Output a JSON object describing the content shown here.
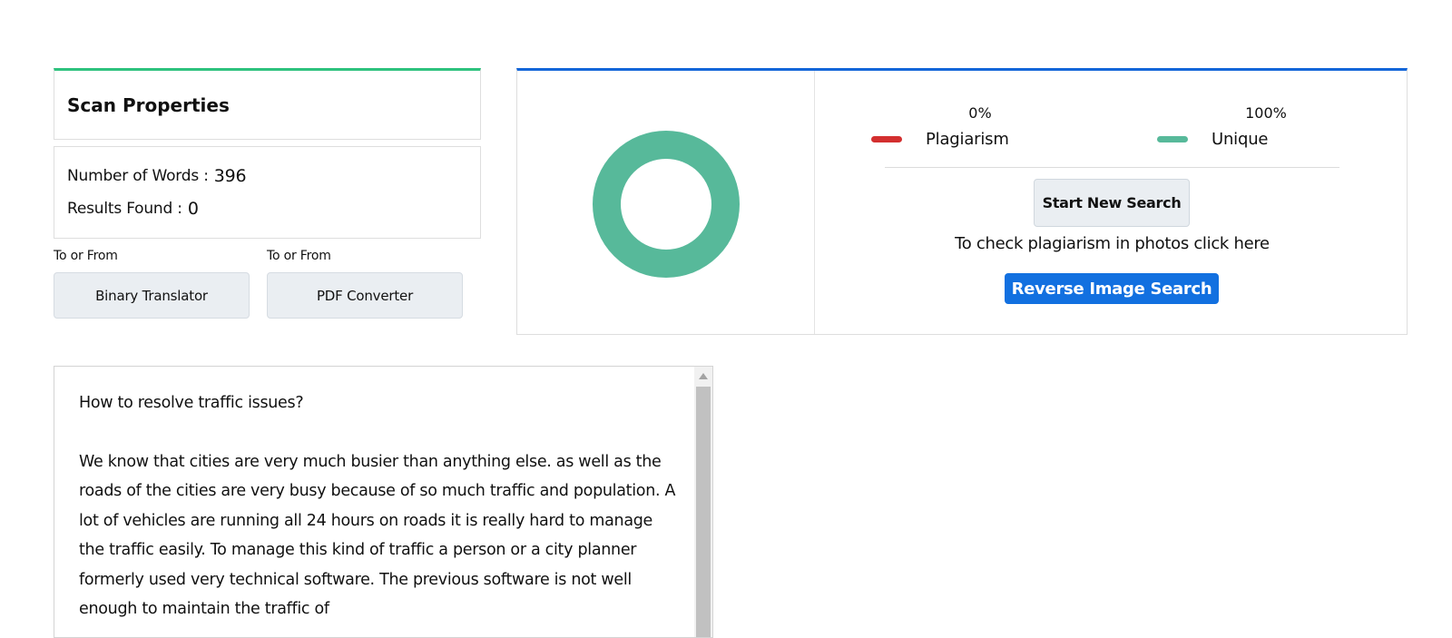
{
  "scan": {
    "title": "Scan Properties",
    "words_label": "Number of Words :",
    "words_value": "396",
    "results_label": "Results Found :",
    "results_value": "0"
  },
  "tools": [
    {
      "label": "To or From",
      "button": "Binary Translator"
    },
    {
      "label": "To or From",
      "button": "PDF Converter"
    }
  ],
  "result": {
    "plagiarism_pct": "0%",
    "plagiarism_label": "Plagiarism",
    "unique_pct": "100%",
    "unique_label": "Unique",
    "plagiarism_value": 0,
    "unique_value": 100,
    "new_search": "Start New Search",
    "photo_text": "To check plagiarism in photos click here",
    "reverse_search": "Reverse Image Search"
  },
  "colors": {
    "plagiarism": "#d32f2f",
    "unique": "#57b99a",
    "accent_green": "#2ec27e",
    "accent_blue": "#1466d9",
    "button_blue": "#1270e0"
  },
  "icons": {
    "scroll_up": "triangle-up-icon"
  },
  "text": {
    "heading": "How to resolve traffic issues?",
    "body": "We know that cities are very much busier than anything else. as well as the roads of the cities are very busy because of so much traffic and population. A lot of vehicles are running all 24 hours on roads it is really hard to manage the traffic easily. To manage this kind of traffic a person or a city planner formerly used very technical software. The previous software is not well enough to maintain the traffic of"
  }
}
